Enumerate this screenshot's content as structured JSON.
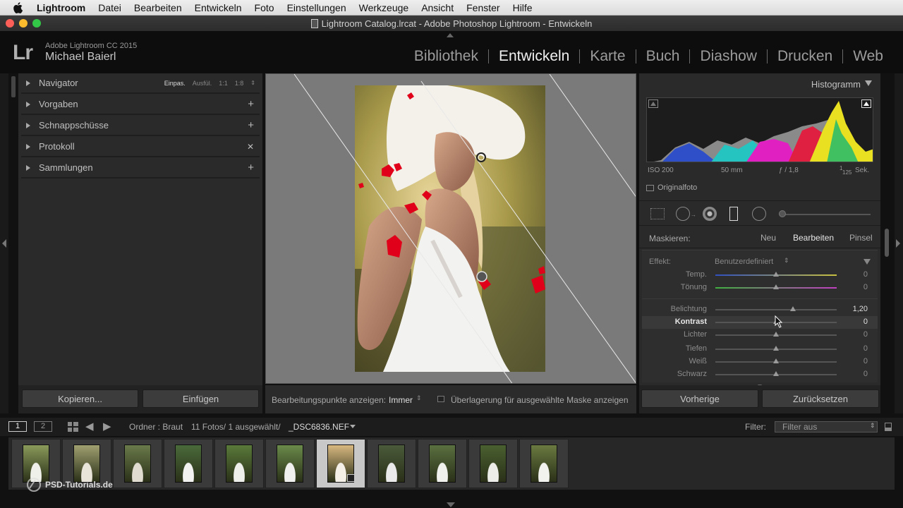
{
  "menubar": {
    "items": [
      "Lightroom",
      "Datei",
      "Bearbeiten",
      "Entwickeln",
      "Foto",
      "Einstellungen",
      "Werkzeuge",
      "Ansicht",
      "Fenster",
      "Hilfe"
    ]
  },
  "window": {
    "title": "Lightroom Catalog.lrcat - Adobe Photoshop Lightroom - Entwickeln"
  },
  "identity": {
    "logo": "Lr",
    "version": "Adobe Lightroom CC 2015",
    "user": "Michael Baierl"
  },
  "modules": [
    "Bibliothek",
    "Entwickeln",
    "Karte",
    "Buch",
    "Diashow",
    "Drucken",
    "Web"
  ],
  "left_panel": {
    "navigator": {
      "label": "Navigator",
      "zoom": [
        "Einpas.",
        "Ausfül.",
        "1:1",
        "1:8"
      ]
    },
    "sections": [
      {
        "label": "Vorgaben",
        "action": "+"
      },
      {
        "label": "Schnappschüsse",
        "action": "+"
      },
      {
        "label": "Protokoll",
        "action": "✕"
      },
      {
        "label": "Sammlungen",
        "action": "+"
      }
    ],
    "copy_label": "Kopieren...",
    "paste_label": "Einfügen"
  },
  "center_toolbar": {
    "edit_points_label": "Bearbeitungspunkte anzeigen:",
    "edit_points_value": "Immer",
    "overlay_label": "Überlagerung für ausgewählte Maske anzeigen"
  },
  "right_panel": {
    "histogram_title": "Histogramm",
    "exif": {
      "iso": "ISO 200",
      "focal": "50 mm",
      "aperture": "ƒ / 1,8",
      "shutter_num": "1",
      "shutter_den": "125",
      "shutter_unit": "Sek."
    },
    "original_photo": "Originalfoto",
    "mask": {
      "label": "Maskieren:",
      "new": "Neu",
      "edit": "Bearbeiten",
      "brush": "Pinsel"
    },
    "effect": {
      "label": "Effekt:",
      "value": "Benutzerdefiniert"
    },
    "sliders": [
      {
        "label": "Temp.",
        "value": "0",
        "position": 0.5
      },
      {
        "label": "Tönung",
        "value": "0",
        "position": 0.5
      },
      {
        "label": "Belichtung",
        "value": "1,20",
        "position": 0.64
      },
      {
        "label": "Kontrast",
        "value": "0",
        "position": 0.5
      },
      {
        "label": "Lichter",
        "value": "0",
        "position": 0.5
      },
      {
        "label": "Tiefen",
        "value": "0",
        "position": 0.5
      },
      {
        "label": "Weiß",
        "value": "0",
        "position": 0.5
      },
      {
        "label": "Schwarz",
        "value": "0",
        "position": 0.5
      }
    ],
    "previous_label": "Vorherige",
    "reset_label": "Zurücksetzen"
  },
  "filmstrip_header": {
    "page1": "1",
    "page2": "2",
    "folder": "Ordner : Braut",
    "count": "11 Fotos/ 1 ausgewählt/",
    "filename": "_DSC6836.NEF",
    "filter_label": "Filter:",
    "filter_value": "Filter aus"
  },
  "filmstrip": {
    "count": 11,
    "selected_index": 6
  },
  "watermark": "PSD-Tutorials.de",
  "colors": {
    "accent_active": "#f0f0f0",
    "clipping_red": "#e0001a",
    "panel_bg": "#2a2a2a"
  }
}
